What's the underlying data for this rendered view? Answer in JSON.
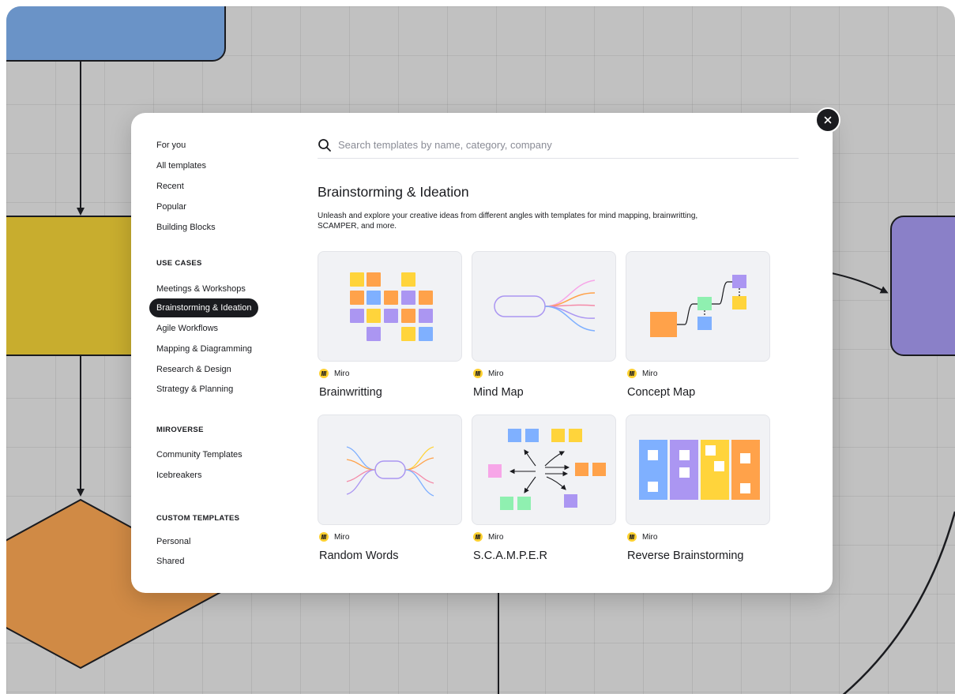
{
  "close": {
    "icon": "close-icon"
  },
  "sidebar": {
    "top_items": [
      {
        "label": "For you"
      },
      {
        "label": "All templates"
      },
      {
        "label": "Recent"
      },
      {
        "label": "Popular"
      },
      {
        "label": "Building Blocks"
      }
    ],
    "sections": [
      {
        "heading": "USE CASES",
        "items": [
          {
            "label": "Meetings & Workshops"
          },
          {
            "label": "Brainstorming & Ideation",
            "active": true
          },
          {
            "label": "Agile Workflows"
          },
          {
            "label": "Mapping & Diagramming"
          },
          {
            "label": "Research & Design"
          },
          {
            "label": "Strategy & Planning"
          }
        ]
      },
      {
        "heading": "MIROVERSE",
        "items": [
          {
            "label": "Community Templates"
          },
          {
            "label": "Icebreakers"
          }
        ]
      },
      {
        "heading": "CUSTOM TEMPLATES",
        "items": [
          {
            "label": "Personal"
          },
          {
            "label": "Shared"
          }
        ]
      }
    ]
  },
  "search": {
    "placeholder": "Search templates by name, category, company",
    "value": "",
    "icon": "search-icon"
  },
  "main": {
    "title": "Brainstorming & Ideation",
    "description": "Unleash and explore your creative ideas from different angles with templates for mind mapping, brainwritting, SCAMPER, and more.",
    "templates": [
      {
        "title": "Brainwritting",
        "author": "Miro",
        "thumbnail": "brainwriting-thumbnail"
      },
      {
        "title": "Mind Map",
        "author": "Miro",
        "thumbnail": "mind-map-thumbnail"
      },
      {
        "title": "Concept Map",
        "author": "Miro",
        "thumbnail": "concept-map-thumbnail"
      },
      {
        "title": "Random Words",
        "author": "Miro",
        "thumbnail": "random-words-thumbnail"
      },
      {
        "title": "S.C.A.M.P.E.R",
        "author": "Miro",
        "thumbnail": "scamper-thumbnail"
      },
      {
        "title": "Reverse Brainstorming",
        "author": "Miro",
        "thumbnail": "reverse-brainstorming-thumbnail"
      }
    ]
  },
  "colors": {
    "canvas_bg": "#c1c1c1",
    "blue_shape": "#6a93c7",
    "yellow_shape": "#c8ad2e",
    "purple_shape": "#8a80c8",
    "orange_shape": "#d08a45",
    "active_nav": "#1a1b1f",
    "miro_yellow": "#ffd02f",
    "sticky_yellow": "#ffd43b",
    "sticky_orange": "#ffa24a",
    "sticky_blue": "#7fb0ff",
    "sticky_purple": "#ab96f2",
    "sticky_green": "#8ff0b0",
    "sticky_pink": "#f7a6e8"
  }
}
